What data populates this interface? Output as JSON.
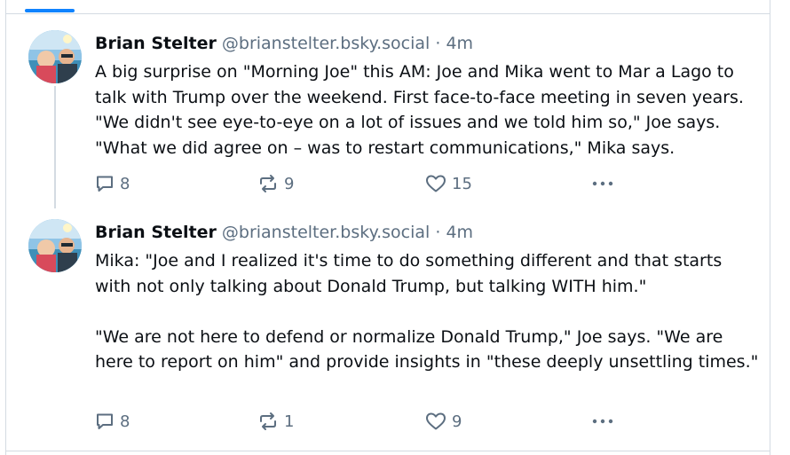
{
  "posts": [
    {
      "author": "Brian Stelter",
      "handle": "@brianstelter.bsky.social",
      "separator": "·",
      "time": "4m",
      "text": "A big surprise on \"Morning Joe\" this AM: Joe and Mika went to Mar a Lago to talk with Trump over the weekend. First face-to-face meeting in seven years. \"We didn't see eye-to-eye on a lot of issues and we told him so,\" Joe says. \"What we did agree on – was to restart communications,\" Mika says.",
      "replies": "8",
      "reposts": "9",
      "likes": "15"
    },
    {
      "author": "Brian Stelter",
      "handle": "@brianstelter.bsky.social",
      "separator": "·",
      "time": "4m",
      "text": "Mika: \"Joe and I realized it's time to do something different and that starts with not only talking about Donald Trump, but talking WITH him.\"\n\n\"We are not here to defend or normalize Donald Trump,\" Joe says. \"We are here to report on him\" and provide insights in \"these deeply unsettling times.\"",
      "replies": "8",
      "reposts": "1",
      "likes": "9"
    }
  ],
  "icons": {
    "reply": "speech-bubble-icon",
    "repost": "repost-arrows-icon",
    "like": "heart-icon",
    "more": "ellipsis-icon"
  },
  "colors": {
    "accent": "#1083fe",
    "muted": "#5c6e80",
    "border": "#d4dbe2",
    "text": "#0b0f14"
  }
}
